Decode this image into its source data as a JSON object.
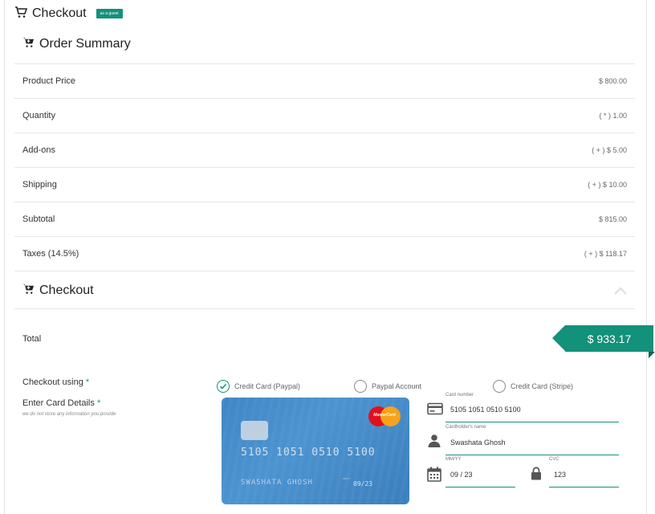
{
  "header": {
    "title": "Checkout",
    "badge": "as a guest",
    "icon": "cart-icon"
  },
  "order_summary": {
    "title": "Order Summary",
    "rows": [
      {
        "label": "Product Price",
        "value": "$ 800.00"
      },
      {
        "label": "Quantity",
        "value": "( * ) 1.00"
      },
      {
        "label": "Add-ons",
        "value": "( + ) $ 5.00"
      },
      {
        "label": "Shipping",
        "value": "( + ) $ 10.00"
      },
      {
        "label": "Subtotal",
        "value": "$ 815.00"
      },
      {
        "label": "Taxes (14.5%)",
        "value": "( + ) $ 118.17"
      }
    ]
  },
  "checkout": {
    "title": "Checkout",
    "total_label": "Total",
    "total_value": "$ 933.17",
    "using_label": "Checkout using",
    "required_mark": "*",
    "card_details_label": "Enter Card Details",
    "privacy_note": "we do not store any information you provide",
    "options": [
      {
        "label": "Credit Card (Paypal)",
        "selected": true
      },
      {
        "label": "Paypal Account",
        "selected": false
      },
      {
        "label": "Credit Card (Stripe)",
        "selected": false
      }
    ]
  },
  "card_preview": {
    "brand": "MasterCard",
    "number": "5105 1051 0510 5100",
    "holder": "SWASHATA GHOSH",
    "expiry_label": "MM/YY",
    "expiry": "09/23"
  },
  "form": {
    "card_number": {
      "label": "Card number",
      "value": "5105 1051 0510 5100"
    },
    "cardholder": {
      "label": "Cardholder's name",
      "value": "Swashata Ghosh"
    },
    "expiry": {
      "label": "MM/YY",
      "value": "09 / 23"
    },
    "cvc": {
      "label": "CVC",
      "value": "123"
    }
  },
  "colors": {
    "accent": "#13917a",
    "card_blue": "#4589c8"
  }
}
